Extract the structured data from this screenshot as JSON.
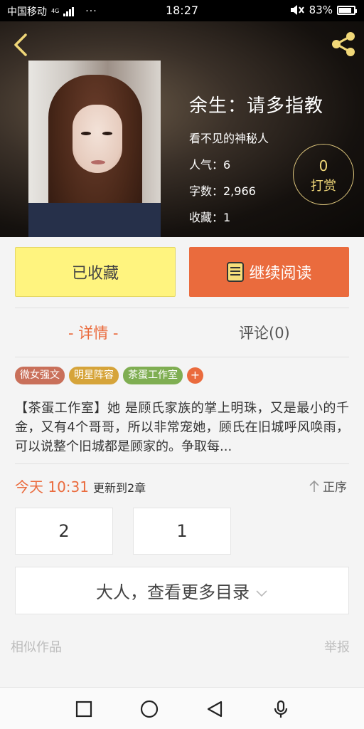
{
  "status_bar": {
    "carrier": "中国移动",
    "network": "4G",
    "more": "···",
    "time": "18:27",
    "battery": "83%",
    "battery_level": 0.83
  },
  "header": {
    "back_icon": "chevron-left-icon",
    "share_icon": "share-icon",
    "accent_color": "#f0d778"
  },
  "book": {
    "title": "余生：请多指教",
    "author": "看不见的神秘人",
    "popularity": "人气：6",
    "word_count": "字数：2,966",
    "favorites": "收藏：1"
  },
  "tip": {
    "count": "0",
    "label": "打赏"
  },
  "actions": {
    "collected_label": "已收藏",
    "read_label": "继续阅读",
    "collected_color": "#fff47f",
    "read_color": "#ea6b3d"
  },
  "tabs": [
    {
      "label": "- 详情 -",
      "active": true
    },
    {
      "label": "评论(0)",
      "active": false
    }
  ],
  "tags": [
    {
      "label": "微女强文",
      "color": "#c9705a"
    },
    {
      "label": "明星阵容",
      "color": "#d6a43a"
    },
    {
      "label": "茶蛋工作室",
      "color": "#7fae52"
    }
  ],
  "tag_more": "+",
  "description": "【茶蛋工作室】她 是顾氏家族的掌上明珠，又是最小的千金，又有4个哥哥，所以非常宠她，顾氏在旧城呼风唤雨，可以说整个旧城都是顾家的。争取每...",
  "update": {
    "time": "今天 10:31",
    "text": "更新到2章",
    "sort_label": "正序"
  },
  "chapters": [
    "2",
    "1"
  ],
  "toc_label": "大人，查看更多目录",
  "footer": {
    "similar": "相似作品",
    "report": "举报"
  },
  "nav": {
    "recent_icon": "square-icon",
    "home_icon": "circle-icon",
    "back_icon": "triangle-back-icon",
    "voice_icon": "microphone-icon"
  }
}
